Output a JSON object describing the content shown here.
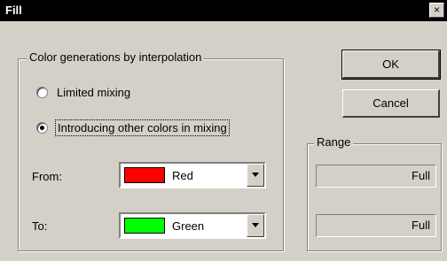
{
  "window": {
    "title": "Fill",
    "close_label": "×"
  },
  "interpolation": {
    "group_label": "Color generations by interpolation",
    "options": [
      {
        "label": "Limited mixing",
        "checked": false
      },
      {
        "label": "Introducing other colors in mixing",
        "checked": true
      }
    ]
  },
  "from": {
    "label": "From:",
    "value": "Red",
    "color": "#ff0000"
  },
  "to": {
    "label": "To:",
    "value": "Green",
    "color": "#00ff00"
  },
  "buttons": {
    "ok": "OK",
    "cancel": "Cancel"
  },
  "range": {
    "group_label": "Range",
    "field_1": "Full",
    "field_2": "Full"
  }
}
